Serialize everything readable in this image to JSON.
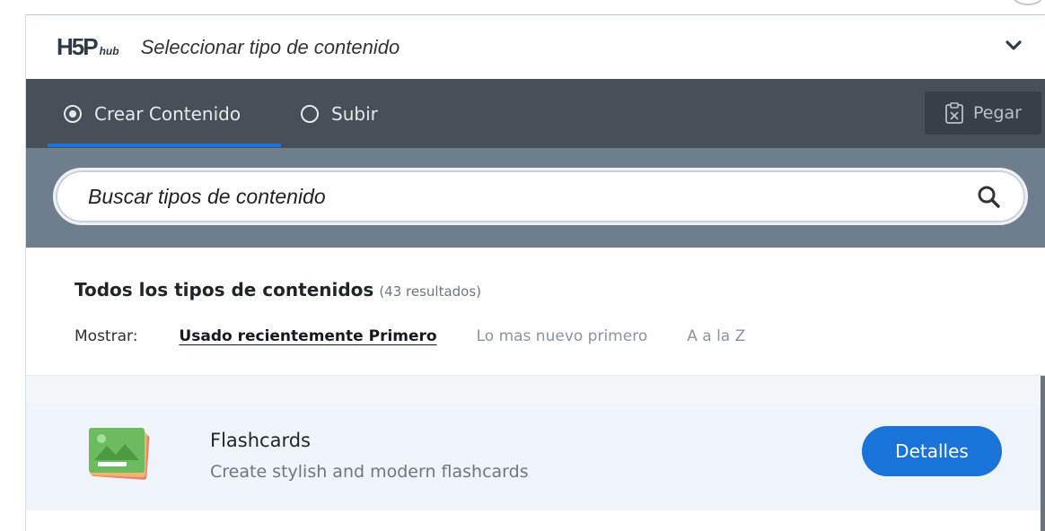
{
  "header": {
    "logo_main": "H5P",
    "logo_sub": "hub",
    "title": "Seleccionar tipo de contenido"
  },
  "tabs": {
    "create_label": "Crear Contenido",
    "upload_label": "Subir",
    "paste_label": "Pegar"
  },
  "search": {
    "placeholder": "Buscar tipos de contenido"
  },
  "results": {
    "title": "Todos los tipos de contenidos",
    "count": "(43 resultados)",
    "sort_label": "Mostrar:",
    "sort_options": [
      "Usado recientemente Primero",
      "Lo mas nuevo primero",
      "A a la Z"
    ]
  },
  "items": [
    {
      "title": "Flashcards",
      "description": "Create stylish and modern flashcards",
      "button_label": "Detalles"
    }
  ],
  "colors": {
    "accent": "#1a73d9",
    "tabs_bg": "#474f58",
    "search_strip": "#6f7e8c"
  }
}
